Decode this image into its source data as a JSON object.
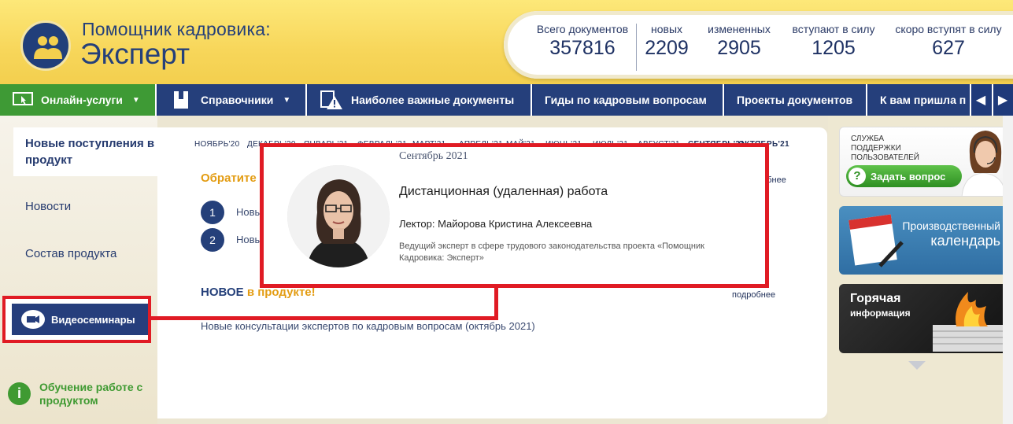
{
  "brand": {
    "line1": "Помощник кадровика:",
    "line2": "Эксперт"
  },
  "stats": [
    {
      "label": "Всего документов",
      "value": "357816"
    },
    {
      "label": "новых",
      "value": "2209"
    },
    {
      "label": "измененных",
      "value": "2905"
    },
    {
      "label": "вступают в силу",
      "value": "1205"
    },
    {
      "label": "скоро вступят в силу",
      "value": "627"
    }
  ],
  "nav": {
    "items": [
      {
        "label": "Онлайн-услуги",
        "icon": "monitor-cursor-icon"
      },
      {
        "label": "Справочники",
        "icon": "book-icon"
      },
      {
        "label": "Наиболее важные документы",
        "icon": "warning-doc-icon"
      },
      {
        "label": "Гиды по кадровым вопросам"
      },
      {
        "label": "Проекты документов"
      },
      {
        "label": "К вам пришла п"
      }
    ],
    "prev": "◀",
    "next": "▶"
  },
  "sidebar": {
    "active": "Новые поступления в продукт",
    "links": [
      "Новости",
      "Состав продукта"
    ],
    "video_button": "Видеосеминары",
    "learn": "Обучение работе с продуктом",
    "learn_icon": "i"
  },
  "main": {
    "months": [
      "НОЯБРЬ'20",
      "ДЕКАБРЬ'20",
      "ЯНВАРЬ'21",
      "ФЕВРАЛЬ'21",
      "МАРТ'21",
      "АПРЕЛЬ'21",
      "МАЙ'21",
      "ИЮНЬ'21",
      "ИЮЛЬ'21",
      "АВГУСТ'21",
      "СЕНТЯБРЬ'21",
      "ОКТЯБРЬ'21"
    ],
    "section1_title": "Обратите",
    "section1_more": "робнее",
    "items": [
      {
        "num": "1",
        "text": "Новы"
      },
      {
        "num": "2",
        "text": "Новы"
      }
    ],
    "section2_title_a": "НОВОЕ",
    "section2_title_b": "в продукте!",
    "section2_more": "подробнее",
    "section2_item": "Новые консультации экспертов по кадровым вопросам (октябрь 2021)"
  },
  "popup": {
    "date": "Сентябрь 2021",
    "title": "Дистанционная (удаленная) работа",
    "lecturer": "Лектор: Майорова Кристина Алексеевна",
    "description": "Ведущий эксперт в сфере трудового законодательства проекта «Помощник Кадровика: Эксперт»"
  },
  "right": {
    "support_text": "СЛУЖБА ПОДДЕРЖКИ ПОЛЬЗОВАТЕЛЕЙ",
    "support_button": "Задать вопрос",
    "support_button_icon": "?",
    "calendar_line1": "Производственный",
    "calendar_line2": "календарь",
    "hot_line1": "Горячая",
    "hot_line2": "информация"
  },
  "colors": {
    "header_yellow": "#f7d65a",
    "nav_blue": "#253f7b",
    "nav_green": "#3e9a35",
    "accent_red": "#e01b24",
    "title_orange": "#e39c12"
  }
}
